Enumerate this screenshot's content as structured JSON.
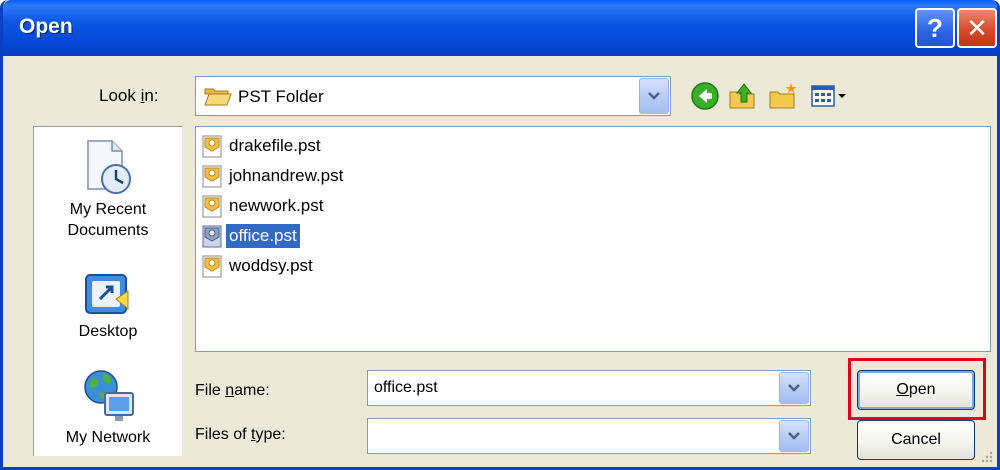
{
  "window": {
    "title": "Open",
    "help_glyph": "?",
    "close_glyph": "✕",
    "accent": "#0a5ff0"
  },
  "lookin": {
    "label_pre": "Look ",
    "label_key": "i",
    "label_post": "n:",
    "value": "PST Folder",
    "folder_icon": "folder-open-icon",
    "toolbar_icons": [
      "back-icon",
      "up-folder-icon",
      "new-folder-icon",
      "view-menu-icon"
    ]
  },
  "places": [
    {
      "label_line1": "My Recent",
      "label_line2": "Documents",
      "icon": "recent-documents-icon"
    },
    {
      "label_line1": "Desktop",
      "label_line2": "",
      "icon": "desktop-icon"
    },
    {
      "label_line1": "My Network",
      "label_line2": "",
      "icon": "network-icon"
    }
  ],
  "files": [
    {
      "name": "drakefile.pst",
      "selected": false
    },
    {
      "name": "johnandrew.pst",
      "selected": false
    },
    {
      "name": "newwork.pst",
      "selected": false
    },
    {
      "name": "office.pst",
      "selected": true
    },
    {
      "name": "woddsy.pst",
      "selected": false
    }
  ],
  "filename": {
    "label_pre": "File ",
    "label_key": "n",
    "label_post": "ame:",
    "value": "office.pst"
  },
  "filetype": {
    "label_pre": "Files of ",
    "label_key": "t",
    "label_post": "ype:",
    "value": ""
  },
  "buttons": {
    "open_key": "O",
    "open_rest": "pen",
    "cancel": "Cancel"
  },
  "colors": {
    "selection": "#316ac5",
    "highlight": "#e0001b",
    "dialog_bg": "#ece9d8"
  }
}
